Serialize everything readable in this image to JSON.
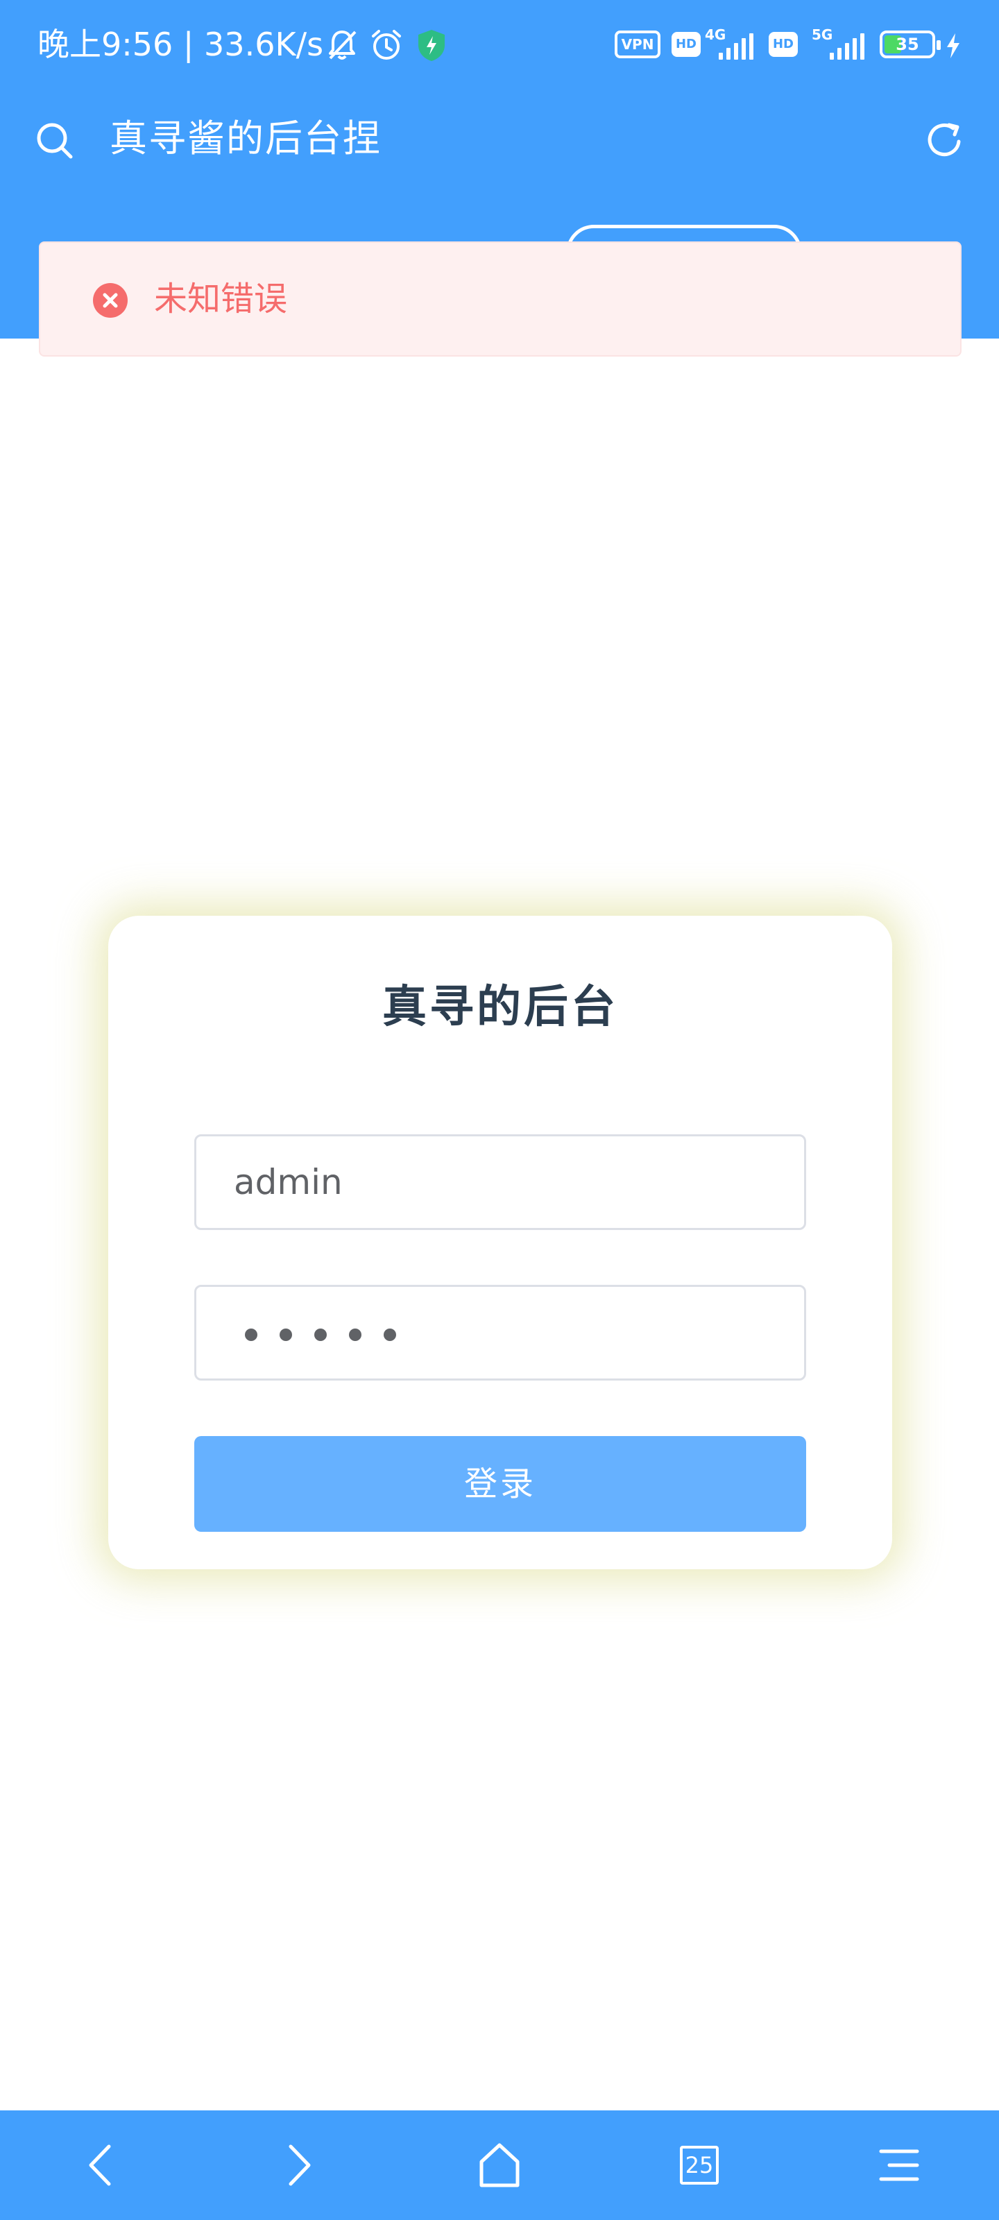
{
  "status_bar": {
    "time_speed": "晚上9:56 | 33.6K/s",
    "vpn_label": "VPN",
    "hd1_label": "HD",
    "net1_label": "4G",
    "hd2_label": "HD",
    "net2_label": "5G",
    "battery_level": "35",
    "icons": [
      "bell-muted-icon",
      "alarm-clock-icon",
      "security-shield-icon",
      "signal-icon",
      "battery-icon",
      "charging-icon"
    ]
  },
  "browser": {
    "page_title": "真寻酱的后台捏",
    "icons": [
      "search-icon",
      "refresh-icon"
    ]
  },
  "toast": {
    "message": "未知错误",
    "color": "#f56c6c"
  },
  "login": {
    "title": "真寻的后台",
    "username_value": "admin",
    "password_length": 5,
    "submit_label": "登录"
  },
  "bottom_nav": {
    "tab_count": "25",
    "icons": [
      "back-arrow-icon",
      "forward-arrow-icon",
      "home-icon",
      "tabs-icon",
      "menu-icon"
    ]
  },
  "colors": {
    "accent": "#429ffd",
    "button": "#66b1ff",
    "error": "#f56c6c",
    "error_bg": "#fef0f0"
  }
}
